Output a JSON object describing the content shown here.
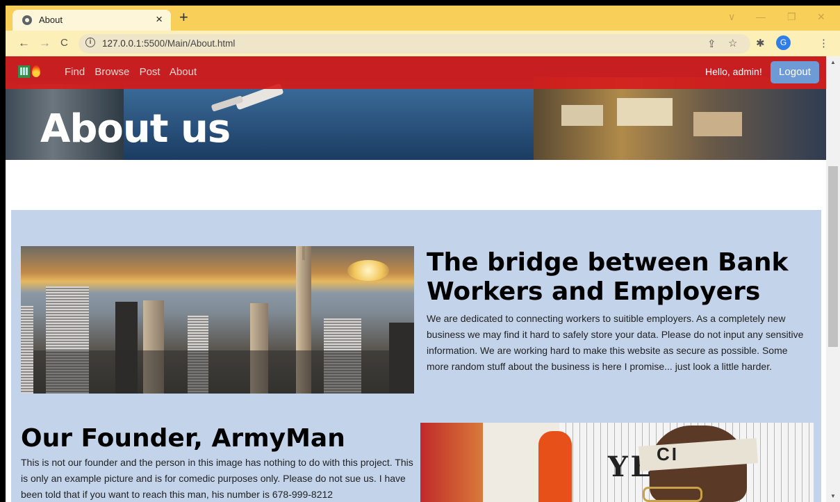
{
  "browser": {
    "tab_title": "About",
    "tab_close": "×",
    "new_tab": "+",
    "url_host": "127.0.0.1",
    "url_path": ":5500/Main/About.html",
    "profile_initial": "G",
    "nav": {
      "back": "←",
      "forward": "→",
      "reload": "C"
    },
    "window_controls": [
      "∨",
      "—",
      "❐",
      "✕"
    ]
  },
  "navbar": {
    "links": [
      "Find",
      "Browse",
      "Post",
      "About"
    ],
    "greeting": "Hello, admin!",
    "logout_label": "Logout"
  },
  "hero": {
    "title": "About us"
  },
  "section1": {
    "heading": "The bridge between Bank Workers and Employers",
    "body": "We are dedicated to connecting workers to suitible employers. As a completely new business we may find it hard to safely store your data. Please do not input any sensitive information. We are working hard to make this website as secure as possible. Some more random stuff about the business is here I promise... just look a little harder."
  },
  "section2": {
    "heading": "Our Founder, ArmyMan",
    "body": "This is not our founder and the person in this image has nothing to do with this project. This is only an example picture and is for comedic purposes only. Please do not sue us. I have been told that if you want to reach this man, his number is 678-999-8212"
  },
  "image2": {
    "jersey_lettering": "YE",
    "headband_text": "CI"
  },
  "colors": {
    "navbar": "#d61c1c",
    "panel": "#c3d3ea",
    "logout": "#6e9bd6",
    "tabbar": "#f8cf58"
  }
}
